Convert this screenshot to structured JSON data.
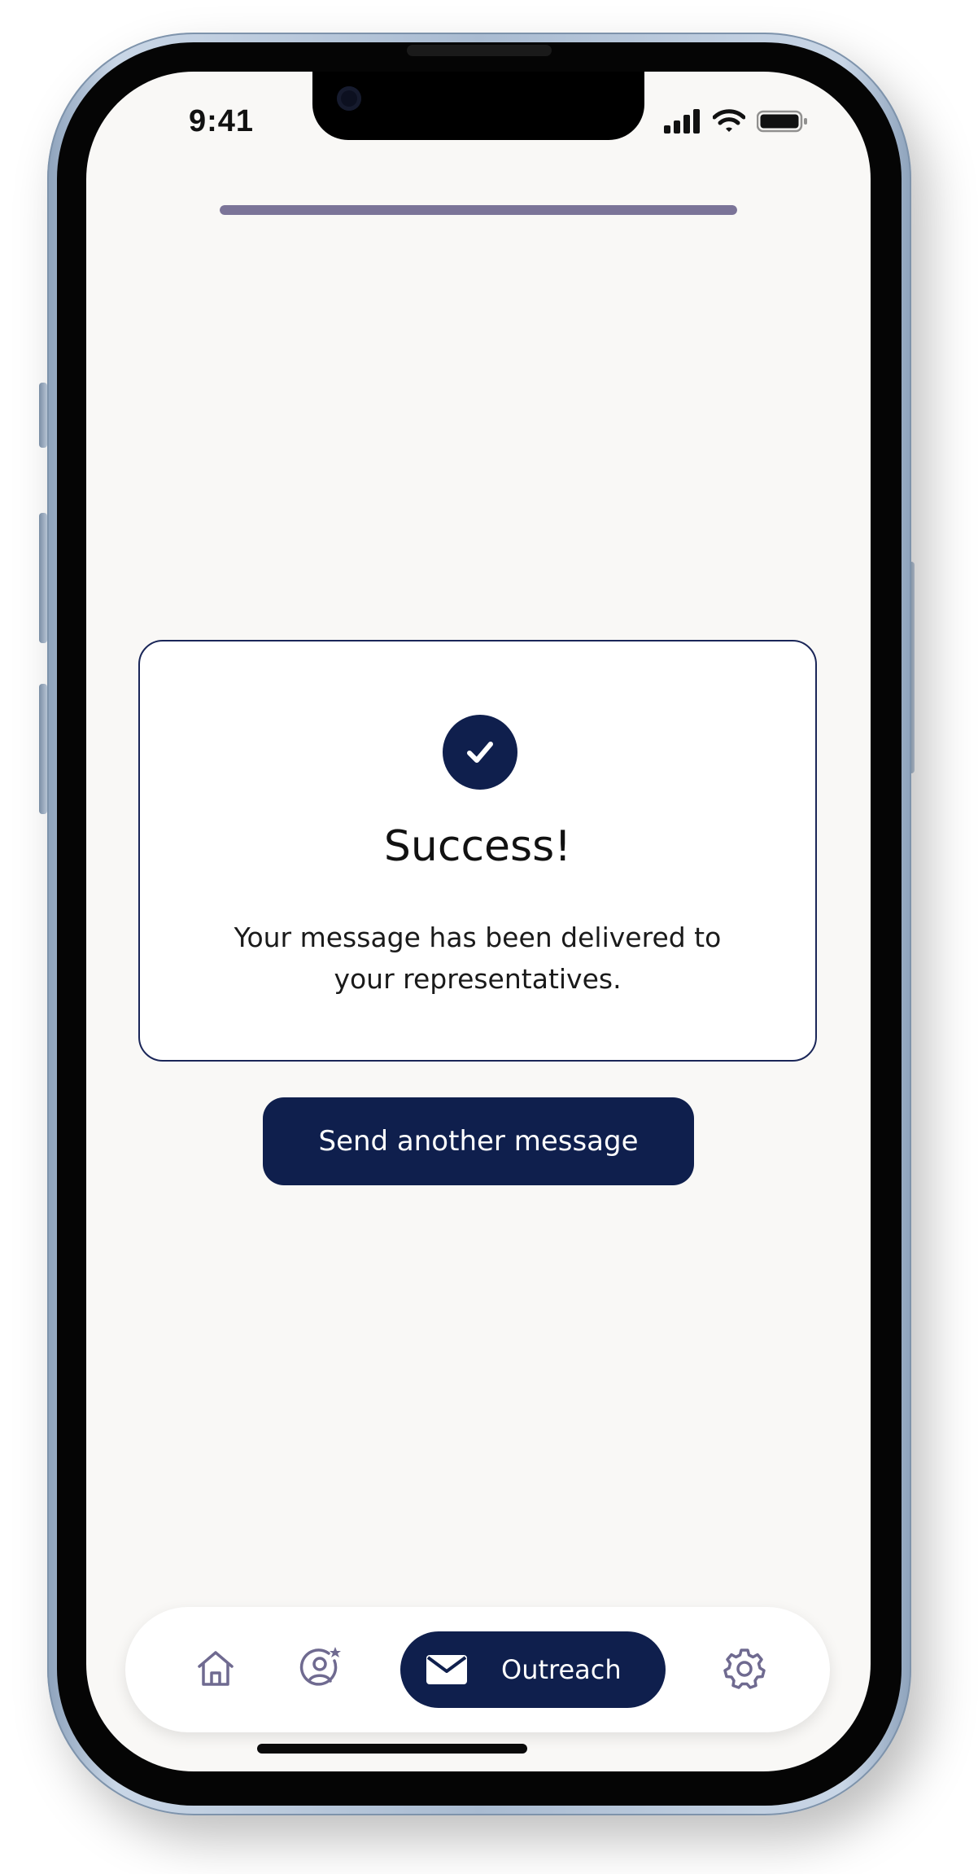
{
  "status_bar": {
    "time": "9:41"
  },
  "progress": {
    "fraction": 1.0
  },
  "success_card": {
    "title": "Success!",
    "message": "Your message has been delivered to your representatives."
  },
  "actions": {
    "send_another_label": "Send another message"
  },
  "tab_bar": {
    "items": [
      {
        "icon": "home-icon",
        "active": false
      },
      {
        "icon": "user-star-icon",
        "active": false
      },
      {
        "icon": "mail-icon",
        "label": "Outreach",
        "active": true
      },
      {
        "icon": "gear-icon",
        "active": false
      }
    ]
  },
  "colors": {
    "primary": "#0f1f4d",
    "progress": "#7b7498",
    "icon_muted": "#6f6a90",
    "screen_bg": "#f9f8f6"
  }
}
